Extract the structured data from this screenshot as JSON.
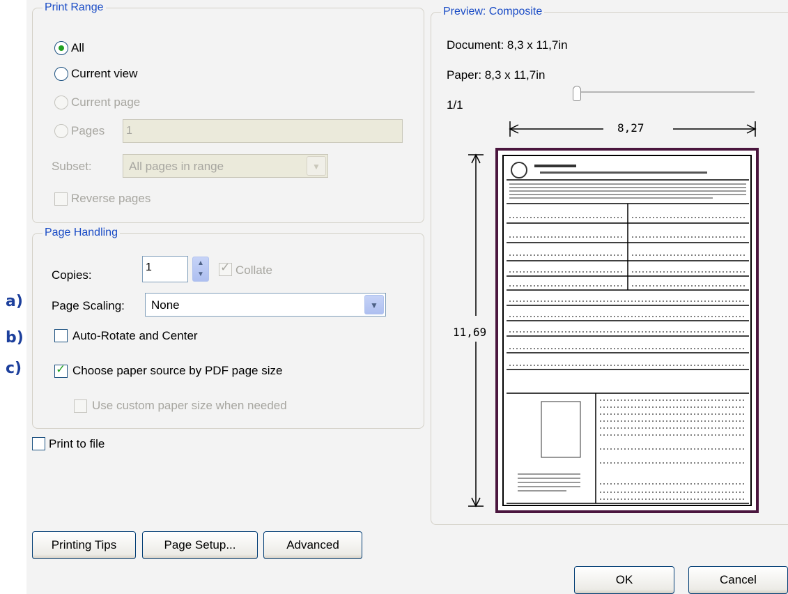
{
  "labels": {
    "a": "a)",
    "b": "b)",
    "c": "c)"
  },
  "print_range": {
    "legend": "Print Range",
    "all": "All",
    "current_view": "Current view",
    "current_page": "Current page",
    "pages": "Pages",
    "pages_value": "1",
    "subset_label": "Subset:",
    "subset_value": "All pages in range",
    "reverse_pages": "Reverse pages"
  },
  "page_handling": {
    "legend": "Page Handling",
    "copies_label": "Copies:",
    "copies_value": "1",
    "collate": "Collate",
    "page_scaling_label": "Page Scaling:",
    "page_scaling_value": "None",
    "auto_rotate": "Auto-Rotate and Center",
    "choose_paper_source": "Choose paper source by PDF page size",
    "custom_paper": "Use custom paper size when needed"
  },
  "print_to_file": "Print to file",
  "preview": {
    "legend": "Preview: Composite",
    "document": "Document: 8,3 x 11,7in",
    "paper": "Paper: 8,3 x 11,7in",
    "page_counter": "1/1",
    "page_position": 0,
    "width_dim": "8,27",
    "height_dim": "11,69"
  },
  "buttons": {
    "printing_tips": "Printing Tips",
    "page_setup": "Page Setup...",
    "advanced": "Advanced",
    "ok": "OK",
    "cancel": "Cancel"
  },
  "state": {
    "all_selected": true,
    "collate_checked": true,
    "auto_rotate_checked": false,
    "choose_paper_source_checked": true,
    "custom_paper_checked": false,
    "reverse_pages_checked": false,
    "print_to_file_checked": false
  },
  "colors": {
    "legend_text": "#1a4cc6",
    "side_label": "#1c3f9c",
    "check_mark": "#21a121",
    "document_border": "#4a163e"
  }
}
